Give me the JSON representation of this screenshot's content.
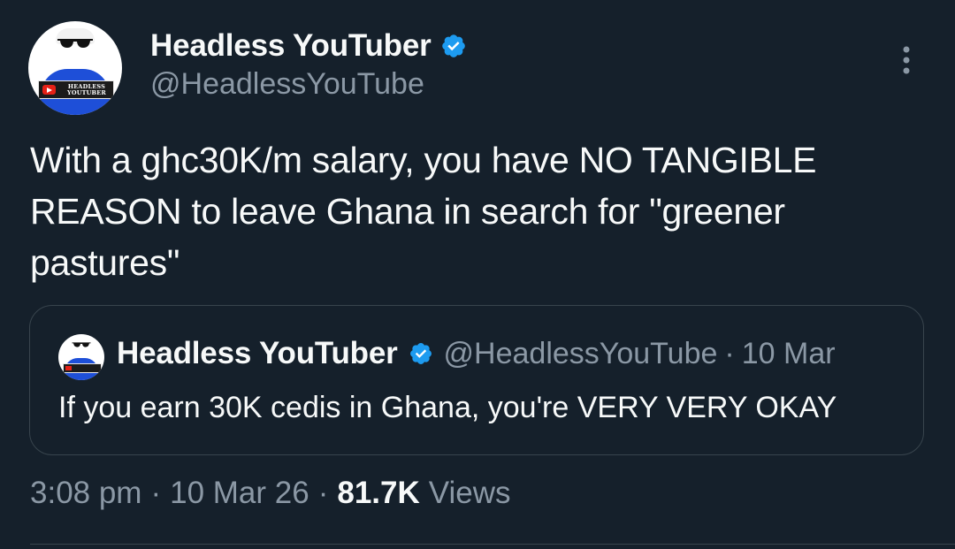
{
  "author": {
    "display_name": "Headless YouTuber",
    "handle": "@HeadlessYouTube",
    "verified": true,
    "avatar_logo_text": "HEADLESS YOUTUBER"
  },
  "tweet": {
    "text": "With a ghc30K/m salary, you have NO TANGIBLE REASON to leave Ghana in search for \"greener pastures\""
  },
  "quoted_tweet": {
    "display_name": "Headless YouTuber",
    "handle": "@HeadlessYouTube",
    "separator": "·",
    "date": "10 Mar",
    "text": "If you earn 30K cedis in Ghana, you're VERY VERY OKAY"
  },
  "meta": {
    "time": "3:08 pm",
    "separator": "·",
    "date": "10 Mar 26",
    "views_count": "81.7K",
    "views_label": "Views"
  },
  "colors": {
    "background": "#15202b",
    "primary_text": "#f7f9f9",
    "secondary_text": "#8b98a5",
    "verified_badge": "#1d9bf0",
    "border": "#38444d"
  },
  "icons": {
    "verified": "verified-badge-icon",
    "more": "more-options-icon"
  }
}
